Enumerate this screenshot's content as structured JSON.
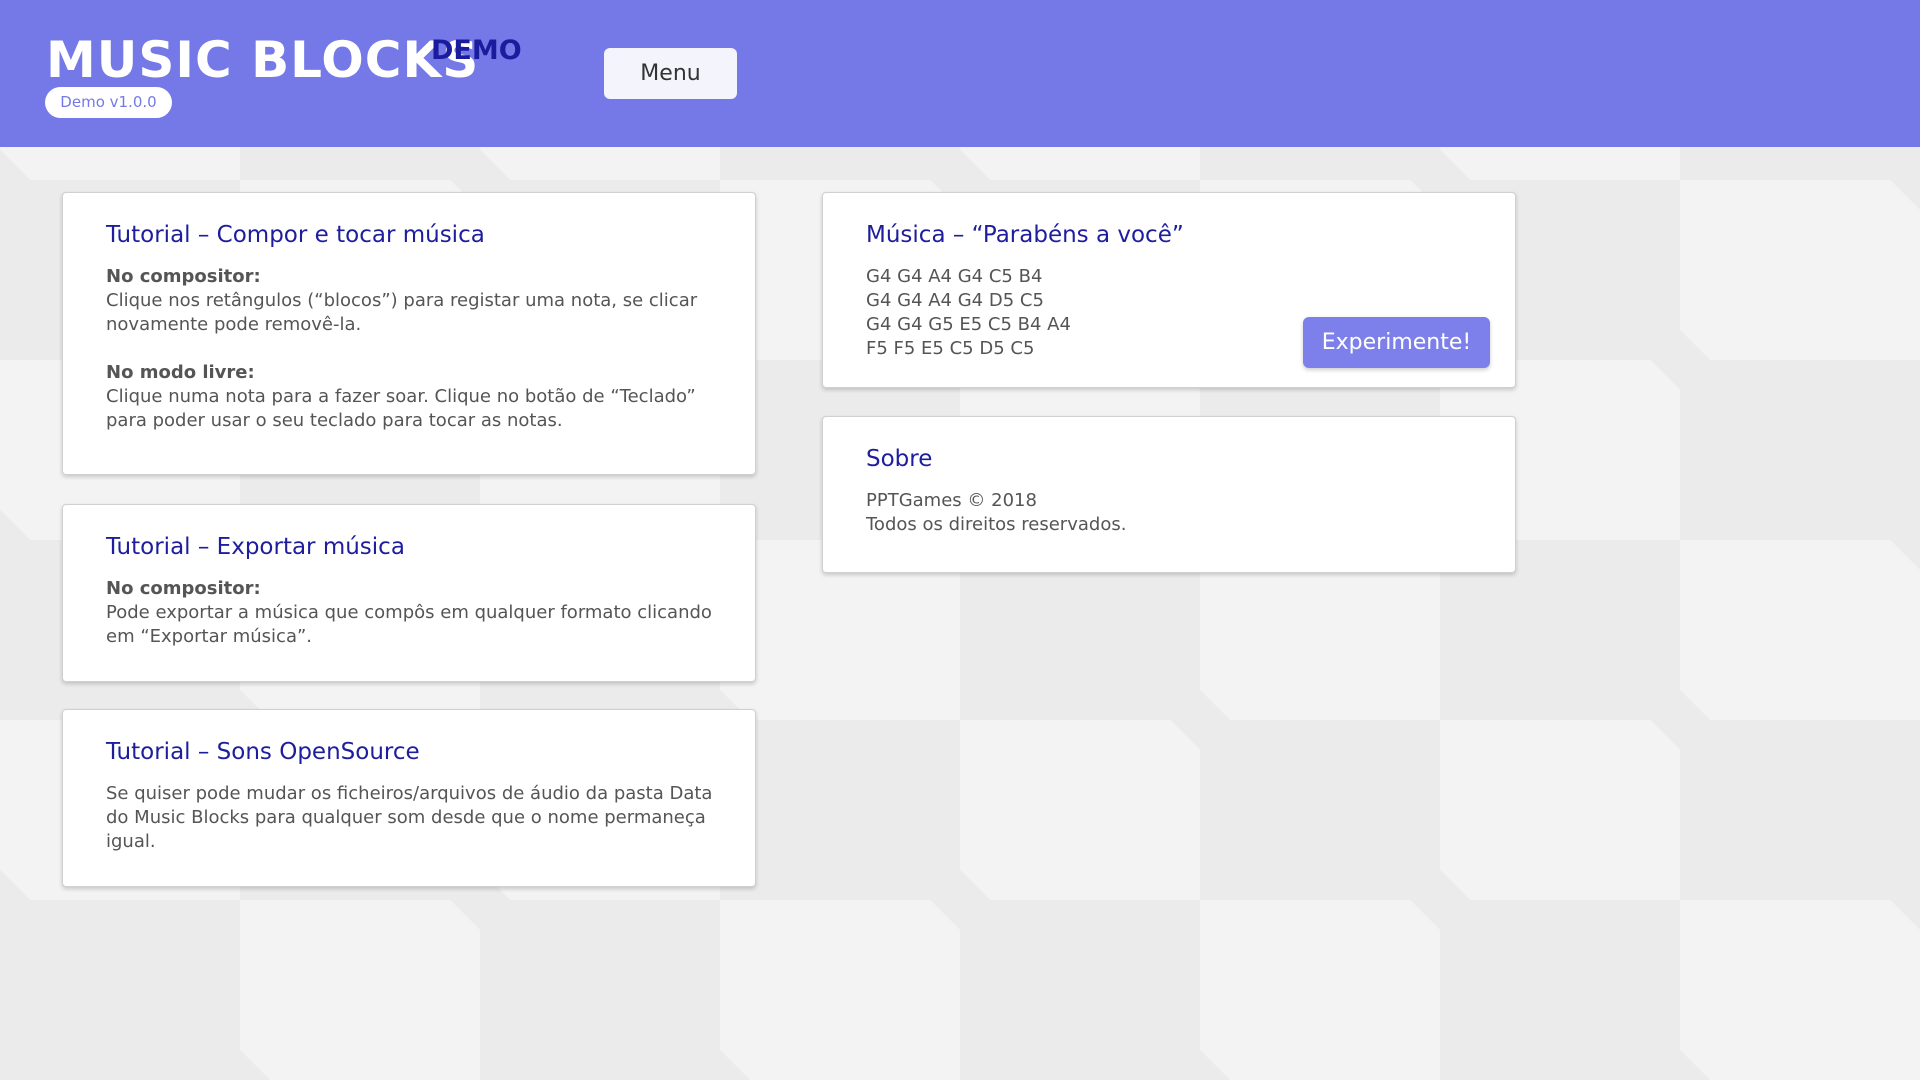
{
  "header": {
    "logo": "MUSIC BLOCKS",
    "logo_tag": "DEMO",
    "version": "Demo v1.0.0",
    "menu_label": "Menu",
    "background_color": "#7579e8"
  },
  "cards": {
    "compose": {
      "title": "Tutorial – Compor e tocar música",
      "composer_heading": "No compositor:",
      "composer_line1": "Clique nos retângulos (“blocos”) para registar uma nota, se clicar",
      "composer_line2": "novamente pode removê-la.",
      "free_heading": "No modo livre:",
      "free_line1": "Clique numa nota para a fazer soar. Clique no botão de “Teclado”",
      "free_line2": "para poder usar o seu teclado para tocar as notas."
    },
    "export": {
      "title": "Tutorial – Exportar música",
      "heading": "No compositor:",
      "line1": "Pode exportar a música que compôs em qualquer formato clicando",
      "line2": "em “Exportar música”."
    },
    "sounds": {
      "title": "Tutorial – Sons OpenSource",
      "line1": "Se quiser pode mudar os ficheiros/arquivos de áudio da pasta Data",
      "line2": "do Music Blocks para qualquer som desde que o nome permaneça",
      "line3": "igual."
    },
    "song": {
      "title": "Música – “Parabéns a você”",
      "notes": [
        "G4 G4 A4 G4 C5 B4",
        "G4 G4 A4 G4 D5 C5",
        "G4 G4 G5 E5 C5 B4 A4",
        "F5 F5 E5 C5 D5 C5"
      ],
      "try_label": "Experimente!"
    },
    "about": {
      "title": "Sobre",
      "line1": "PPTGames © 2018",
      "line2": "Todos os direitos reservados."
    }
  }
}
